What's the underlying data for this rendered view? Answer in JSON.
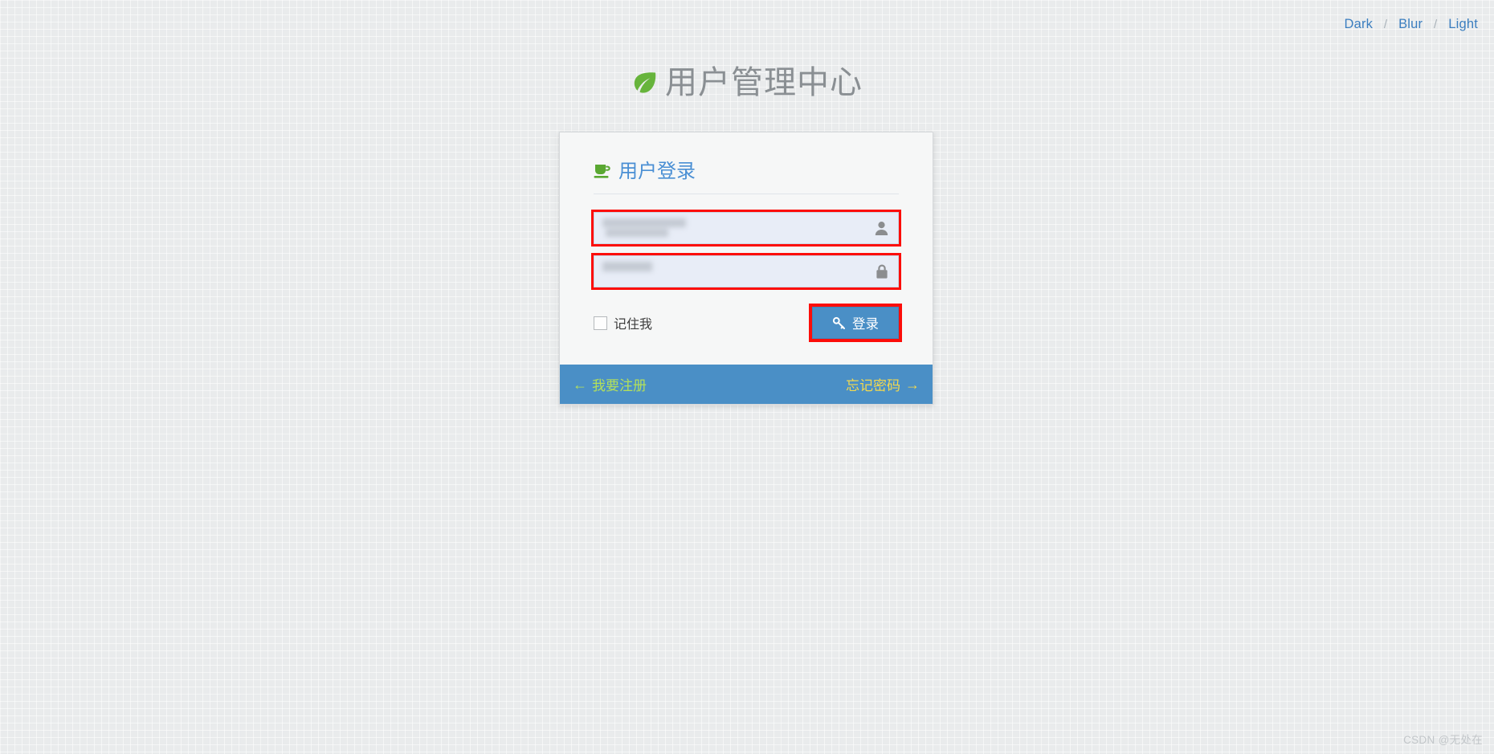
{
  "theme_switch": {
    "options": [
      {
        "label": "Dark",
        "name": "theme-dark"
      },
      {
        "label": "Blur",
        "name": "theme-blur"
      },
      {
        "label": "Light",
        "name": "theme-light"
      }
    ],
    "separator": "/"
  },
  "header": {
    "title": "用户管理中心",
    "logo_icon": "leaf-icon"
  },
  "login_card": {
    "heading": "用户登录",
    "heading_icon": "coffee-cup-icon",
    "username": {
      "value": "",
      "placeholder": "",
      "icon": "user-icon",
      "redacted": true,
      "annotated": true
    },
    "password": {
      "value": "",
      "placeholder": "",
      "icon": "lock-icon",
      "redacted": true,
      "annotated": true
    },
    "remember_me": {
      "label": "记住我",
      "checked": false
    },
    "login_button": {
      "label": "登录",
      "icon": "key-icon",
      "annotated": true
    },
    "footer": {
      "register_label": "我要注册",
      "register_arrow": "←",
      "forgot_label": "忘记密码",
      "forgot_arrow": "→"
    }
  },
  "watermark": "CSDN @无处在",
  "colors": {
    "page_bg": "#e9ebec",
    "card_bg": "#f6f7f7",
    "accent_blue": "#4a8fc6",
    "heading_blue": "#4a8fd4",
    "link_blue": "#3b7ebf",
    "leaf_green": "#67b43c",
    "annotation_red": "#fc0d09",
    "input_bg": "#e8edf7",
    "register_green": "#b4e05a",
    "forgot_yellow": "#f3d94e",
    "title_gray": "#8a8f93"
  }
}
